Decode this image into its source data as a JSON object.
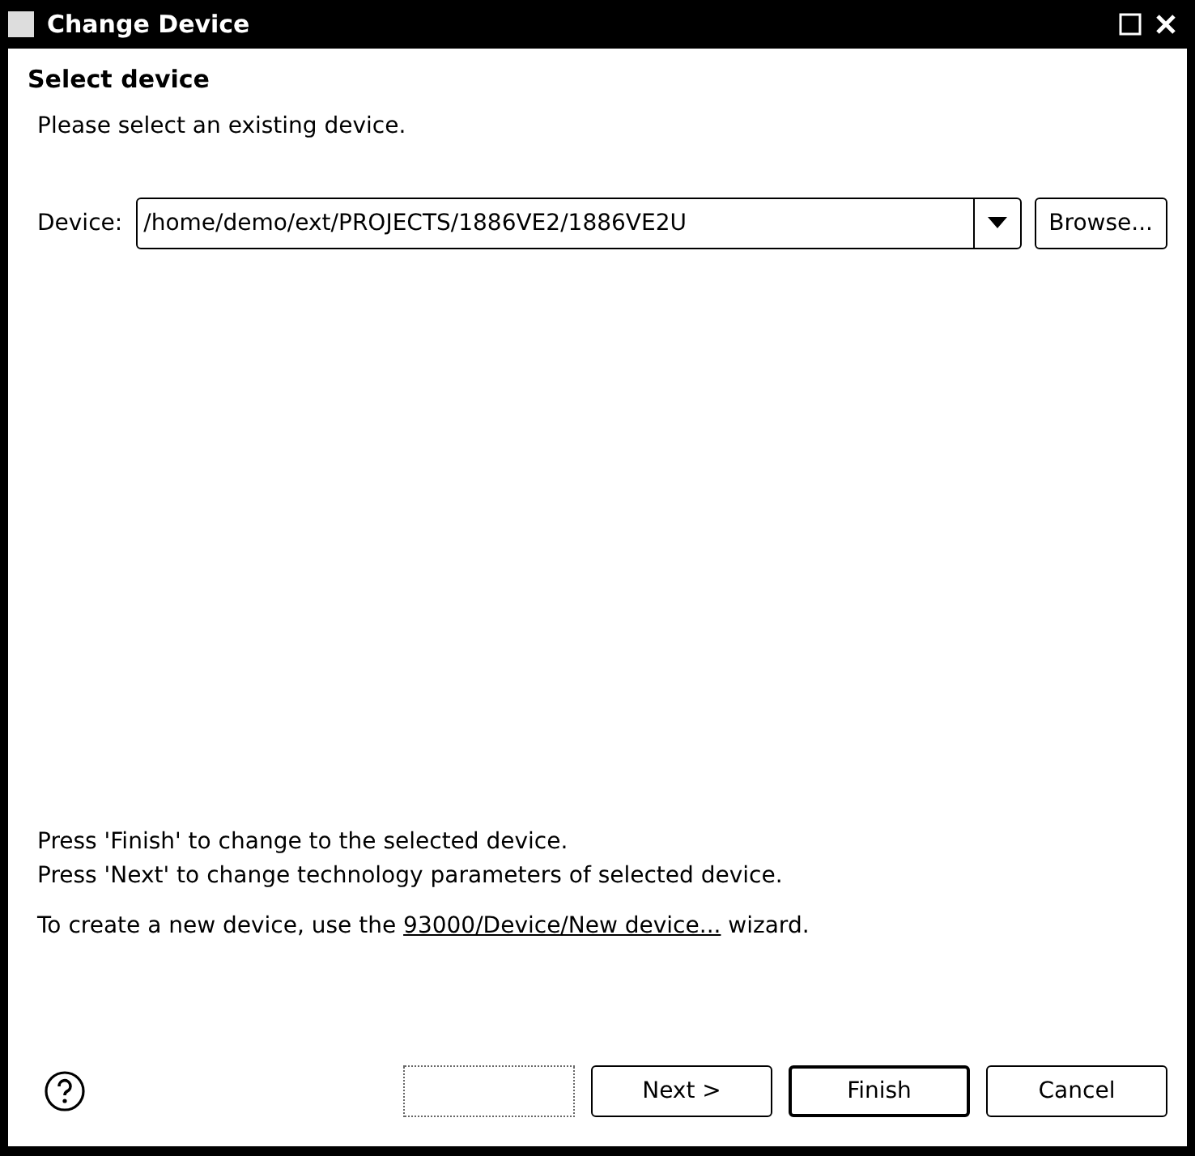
{
  "window": {
    "title": "Change Device"
  },
  "header": {
    "title": "Select device",
    "description": "Please select an existing device."
  },
  "device_field": {
    "label": "Device:",
    "value": "/home/demo/ext/PROJECTS/1886VE2/1886VE2U",
    "browse": "Browse..."
  },
  "info": [
    "Press 'Finish' to change to the selected device.",
    "Press 'Next' to change technology parameters of selected device."
  ],
  "hint": {
    "before": "To create a new device, use the ",
    "link": "93000/Device/New device...",
    "after": " wizard."
  },
  "buttons": [
    {
      "kind": "blank"
    },
    {
      "kind": "push",
      "label": "Next >",
      "default": false
    },
    {
      "kind": "push",
      "label": "Finish",
      "default": true
    },
    {
      "kind": "push",
      "label": "Cancel",
      "default": false
    }
  ]
}
